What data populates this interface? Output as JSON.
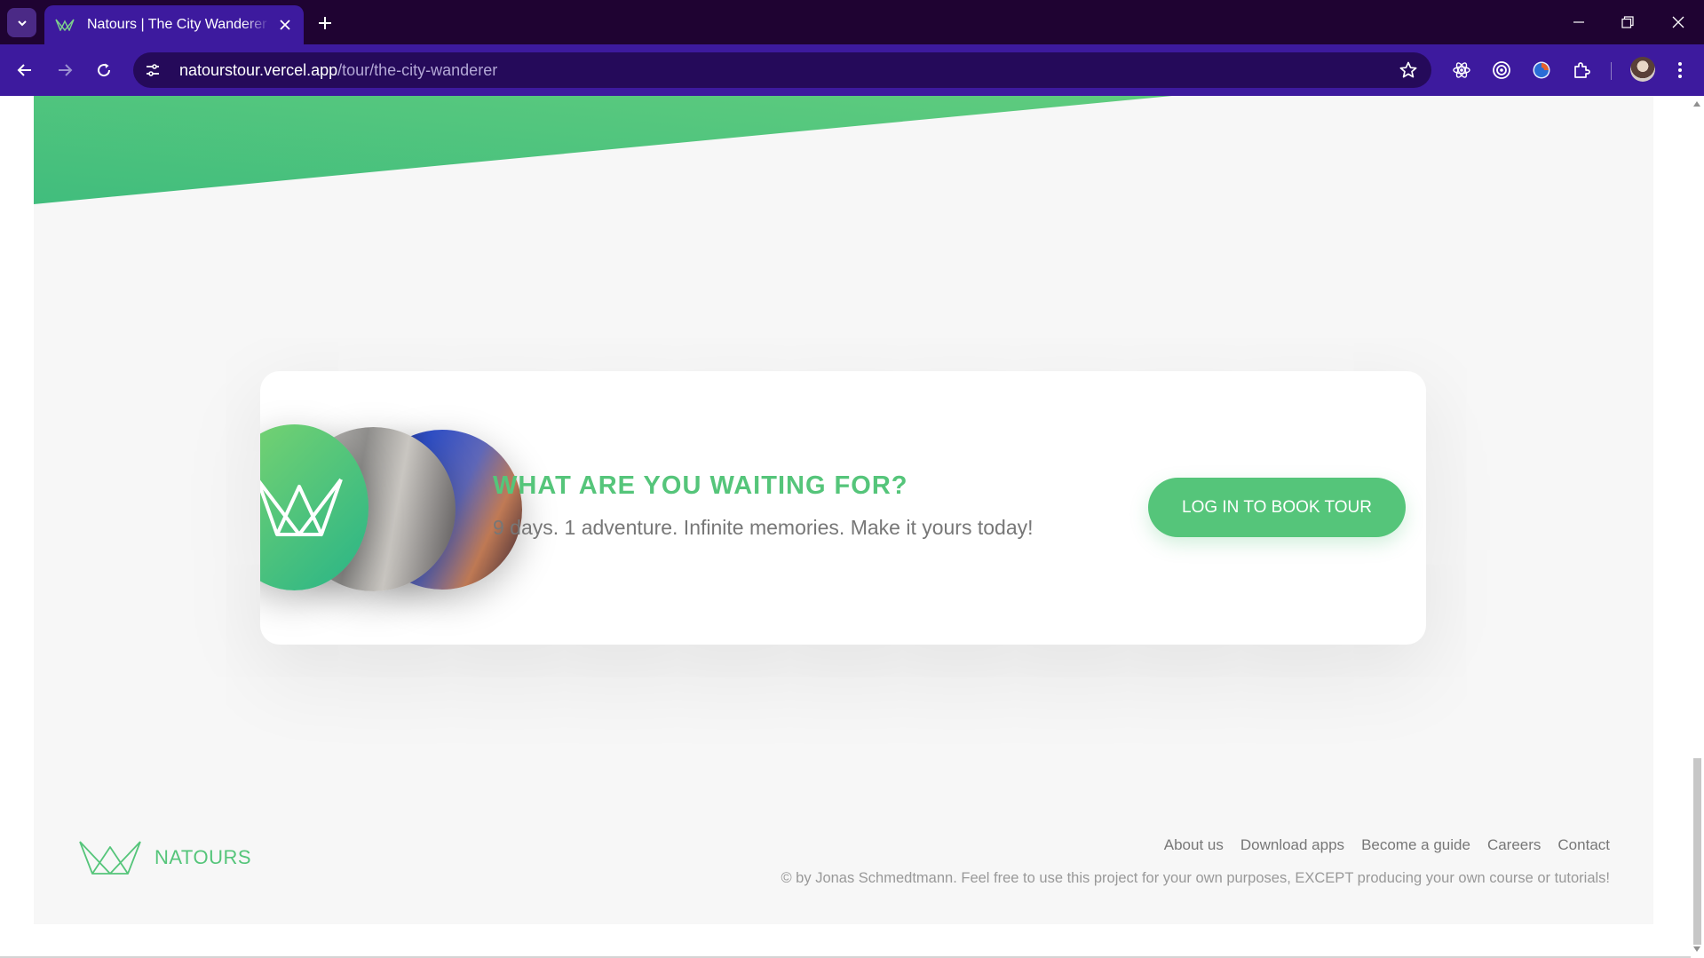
{
  "browser": {
    "tab_title": "Natours | The City Wanderer Tour",
    "url_host": "natourstour.vercel.app",
    "url_path": "/tour/the-city-wanderer",
    "icons": {
      "tab_search": "chevron-down-icon",
      "favicon": "natours-logo-icon",
      "tab_close": "close-icon",
      "new_tab": "plus-icon",
      "back": "arrow-left-icon",
      "forward": "arrow-right-icon",
      "reload": "reload-icon",
      "site_info": "tune-icon",
      "bookmark": "star-icon",
      "extensions": [
        "react-devtools-icon",
        "target-icon",
        "color-picker-icon",
        "puzzle-icon"
      ],
      "menu": "kebab-menu-icon"
    }
  },
  "cta": {
    "heading": "WHAT ARE YOU WAITING FOR?",
    "text": "9 days. 1 adventure. Infinite memories. Make it yours today!",
    "button_label": "LOG IN TO BOOK TOUR"
  },
  "footer": {
    "brand": "NATOURS",
    "nav": {
      "about": "About us",
      "download": "Download apps",
      "guide": "Become a guide",
      "careers": "Careers",
      "contact": "Contact"
    },
    "copyright": "© by Jonas Schmedtmann. Feel free to use this project for your own purposes, EXCEPT producing your own course or tutorials!"
  },
  "colors": {
    "brand_green": "#55c57a",
    "brand_green_dark": "#28b487",
    "tabbar_bg": "#1f0332",
    "toolbar_bg": "#3d1a9e"
  }
}
